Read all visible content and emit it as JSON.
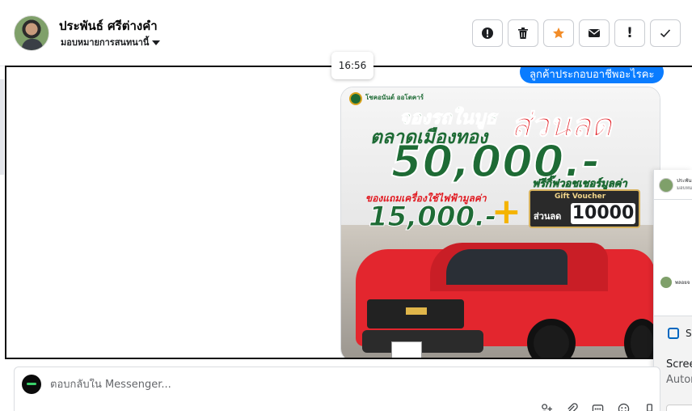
{
  "header": {
    "contact_name": "ประพันธ์ ศรีต่างคำ",
    "assign_label": "มอบหมายการสนทนานี้",
    "actions": [
      {
        "name": "report-spam-icon",
        "glyph": "!"
      },
      {
        "name": "trash-icon",
        "glyph": "🗑"
      },
      {
        "name": "star-icon",
        "glyph": "★"
      },
      {
        "name": "mail-icon",
        "glyph": "✉"
      },
      {
        "name": "follow-up-icon",
        "glyph": "!"
      },
      {
        "name": "checkmark-icon",
        "glyph": "✓"
      }
    ],
    "star_color": "#f28c28"
  },
  "conversation": {
    "bubble_text": "ลูกค้าประกอบอาชีพอะไรคะ",
    "timestamp": "16:56",
    "bubble_color": "#0a7cff"
  },
  "promo_image": {
    "brand": "โชคอนันต์ ออโตคาร์",
    "title_line1": "จองรถในบูธ",
    "title_line2": "ตลาดเมืองทอง",
    "discount_word": "ส่วนลด",
    "big_amount": "50,000.-",
    "gift_label": "ของแถมเครื่องใช้ไฟฟ้ามูลค่า",
    "gift_amount": "15,000.-",
    "plus": "+",
    "free_label": "ฟรีกิ๊ฟวอชเชอร์มูลค่า",
    "voucher_title": "Gift Voucher",
    "voucher_label": "ส่วนลด",
    "voucher_amount": "10000"
  },
  "side_panel": {
    "mini_line1": "ประพันธ์",
    "mini_line2": "มอบหมาย",
    "mini_line3": "พลอยจ",
    "snip_letter": "S",
    "screen_text": "Scree",
    "auto_text": "Autor"
  },
  "reply": {
    "placeholder": "ตอบกลับใน Messenger...",
    "tools": [
      {
        "name": "add-person-icon",
        "glyph": "⚲"
      },
      {
        "name": "attachment-icon",
        "glyph": "⌁"
      },
      {
        "name": "saved-reply-icon",
        "glyph": "▤"
      },
      {
        "name": "emoji-icon",
        "glyph": "☺"
      },
      {
        "name": "more-icon",
        "glyph": "⋮"
      }
    ]
  }
}
